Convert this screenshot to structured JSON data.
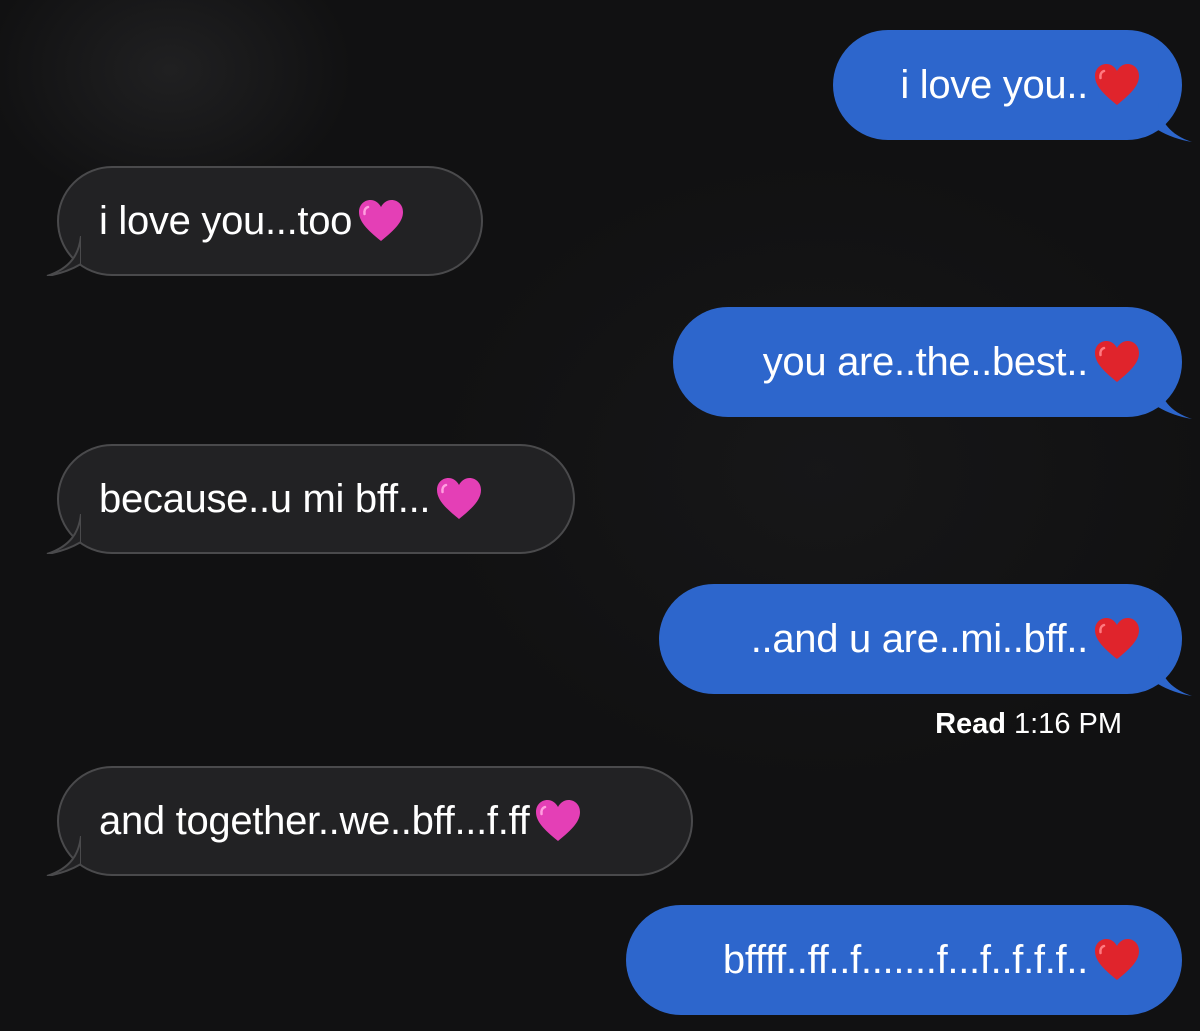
{
  "messages": [
    {
      "direction": "outgoing",
      "text": "i love you..",
      "emoji": "red-heart"
    },
    {
      "direction": "incoming",
      "text": "i love you...too",
      "emoji": "pink-heart"
    },
    {
      "direction": "outgoing",
      "text": "you are..the..best..",
      "emoji": "red-heart"
    },
    {
      "direction": "incoming",
      "text": "because..u mi bff...",
      "emoji": "pink-heart"
    },
    {
      "direction": "outgoing",
      "text": "..and u are..mi..bff..",
      "emoji": "red-heart"
    },
    {
      "direction": "incoming",
      "text": "and together..we..bff...f.ff",
      "emoji": "pink-heart"
    },
    {
      "direction": "outgoing",
      "text": "bffff..ff..f.......f...f..f.f.f..",
      "emoji": "red-heart"
    }
  ],
  "receipt": {
    "label": "Read",
    "time": "1:16 PM"
  },
  "colors": {
    "outgoing_bubble": "#2d66cc",
    "incoming_bubble": "#222224",
    "incoming_border": "#4a4a4c",
    "background": "#111112",
    "red_heart": "#e0242c",
    "pink_heart": "#e43fb6"
  }
}
